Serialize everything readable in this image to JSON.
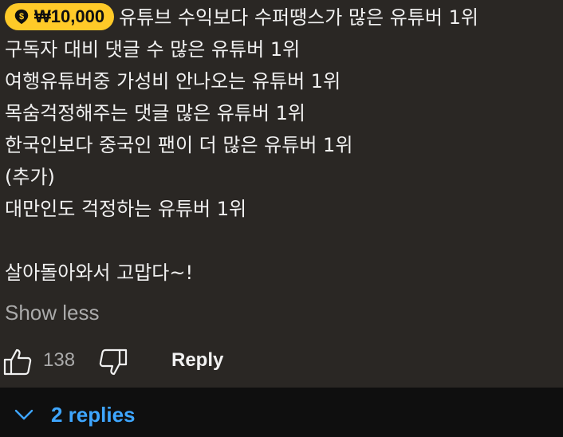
{
  "comment": {
    "super_thanks": {
      "amount": "₩10,000",
      "icon": "super-thanks-dollar-icon",
      "color": "#ffca28"
    },
    "lines": [
      "유튜브 수익보다 수퍼땡스가 많은 유튜버 1위",
      "구독자 대비 댓글 수 많은 유튜버 1위",
      "여행유튜버중 가성비 안나오는 유튜버 1위",
      "목숨걱정해주는 댓글 많은 유튜버 1위",
      "한국인보다 중국인 팬이 더 많은 유튜버 1위",
      "(추가)",
      "대만인도 걱정하는 유튜버 1위",
      "",
      "살아돌아와서 고맙다~!"
    ],
    "show_less_label": "Show less"
  },
  "actions": {
    "like_icon": "thumbs-up-icon",
    "like_count": "138",
    "dislike_icon": "thumbs-down-icon",
    "reply_label": "Reply"
  },
  "replies": {
    "icon": "chevron-down-icon",
    "label": "2 replies",
    "accent_color": "#3ea6ff"
  }
}
